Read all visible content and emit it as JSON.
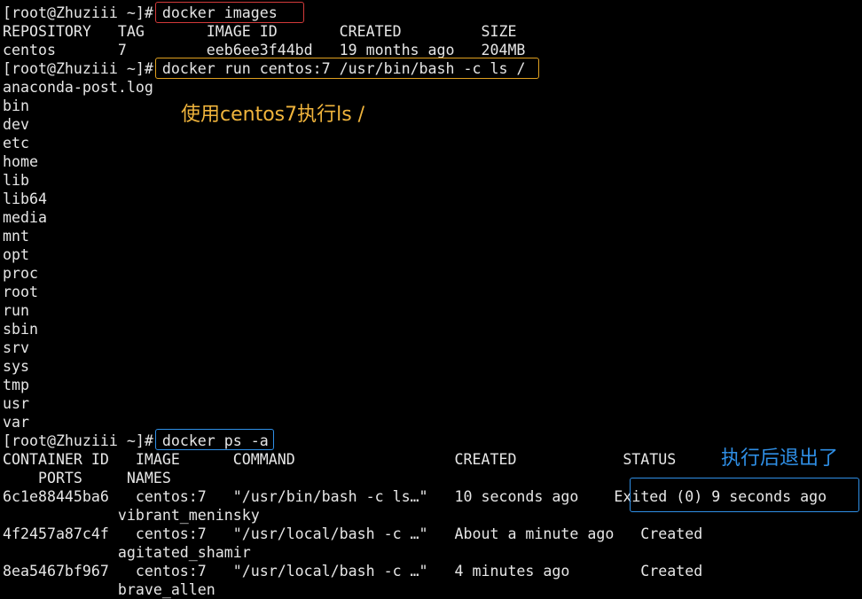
{
  "terminal": {
    "prompt": "[root@Zhuziii ~]#",
    "cmd1": "docker images",
    "images_header": "REPOSITORY   TAG       IMAGE ID       CREATED         SIZE",
    "images_row": "centos       7         eeb6ee3f44bd   19 months ago   204MB",
    "cmd2": "docker run centos:7 /usr/bin/bash -c ls /",
    "ls_output": [
      "anaconda-post.log",
      "bin",
      "dev",
      "etc",
      "home",
      "lib",
      "lib64",
      "media",
      "mnt",
      "opt",
      "proc",
      "root",
      "run",
      "sbin",
      "srv",
      "sys",
      "tmp",
      "usr",
      "var"
    ],
    "cmd3": "docker ps -a",
    "ps_header_1": "CONTAINER ID   IMAGE      COMMAND                  CREATED            STATUS",
    "ps_header_2": "    PORTS     NAMES",
    "ps_rows": [
      {
        "line1": "6c1e88445ba6   centos:7   \"/usr/bin/bash -c ls…\"   10 seconds ago    ",
        "status": "Exited (0) 9 seconds ago",
        "line2": "             vibrant_meninsky"
      },
      {
        "line1": "4f2457a87c4f   centos:7   \"/usr/local/bash -c …\"   About a minute ago   Created",
        "line2": "             agitated_shamir"
      },
      {
        "line1": "8ea5467bf967   centos:7   \"/usr/local/bash -c …\"   4 minutes ago        Created",
        "line2": "             brave_allen"
      }
    ]
  },
  "annotations": {
    "note_run": "使用centos7执行ls /",
    "note_exited": "执行后退出了"
  },
  "colors": {
    "background": "#000000",
    "text": "#e6e6e6",
    "box_images": "#d23a3a",
    "box_run": "#e0a020",
    "box_ps": "#2f8fe6",
    "note_orange": "#f0b43c",
    "note_blue": "#2f8fe6"
  }
}
